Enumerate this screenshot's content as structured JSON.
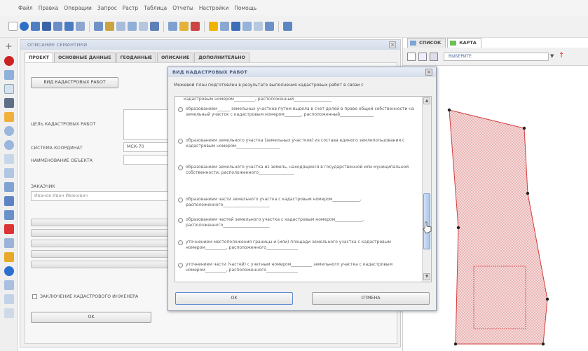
{
  "menu": [
    "Файл",
    "Правка",
    "Операции",
    "Запрос",
    "Растр",
    "Таблица",
    "Отчеты",
    "Настройки",
    "Помощь"
  ],
  "semantics_panel": {
    "title": "ОПИСАНИЕ СЕМАНТИКИ",
    "tabs": [
      "ПРОЕКТ",
      "ОСНОВНЫЕ ДАННЫЕ",
      "ГЕОДАННЫЕ",
      "ОПИСАНИЕ",
      "ДОПОЛНИТЕЛЬНО"
    ],
    "work_type_button": "ВИД КАДАСТРОВЫХ РАБОТ",
    "purpose_label": "ЦЕЛЬ КАДАСТРОВЫХ РАБОТ",
    "coord_system_label": "СИСТЕМА КООРДИНАТ",
    "coord_system_value": "МСК-70",
    "object_name_label": "НАИМЕНОВАНИЕ ОБЪЕКТА",
    "customer_label": "ЗАКАЗЧИК",
    "customer_value": "Иванов Иван Иванович",
    "conclusion_label": "ЗАКЛЮЧЕНИЕ КАДАСТРОВОГО ИНЖЕНЕРА",
    "ok_button": "OK"
  },
  "map_panel": {
    "tab_list": "СПИСОК",
    "tab_map": "КАРТА",
    "select_value": "ВЫБЕРИТЕ"
  },
  "dialog": {
    "title": "ВИД КАДАСТРОВЫХ РАБОТ",
    "intro": "Межевой план подготовлен в результате выполнения кадастровых работ в связи с",
    "top_line": "кадастровым номером__________, расположенный__________________",
    "options": [
      "образованием______ земельных участков путем выдела в счет долей в праве общей собственности на земельный участок с кадастровым номером________, расположенный________________",
      "образованием земельного участка (земельных участков) из состава единого землепользования с кадастровым номером_____________________",
      "образованием земельного участка из земель, находящихся в государственной или муниципальной собственности, расположенного_________________",
      "образованием части земельного участка с кадастровым номером_____________, расположенного______________________",
      "образованием частей земельного участка с кадастровым номером_____________, расположенного______________________",
      "уточнением местоположения границы и (или) площади земельного участка с кадастровым номером__________, расположенного_______________",
      "уточнением части (частей) с учетным номером__________ земельного участка с кадастровым номером__________, расположенного_______________"
    ],
    "ok_button": "OK",
    "cancel_button": "ОТМЕНА"
  },
  "colors": {
    "parcel_outline": "#d23c3c",
    "parcel_fill": "#f3c6c6",
    "scroll_thumb": "#a9c6ec"
  }
}
